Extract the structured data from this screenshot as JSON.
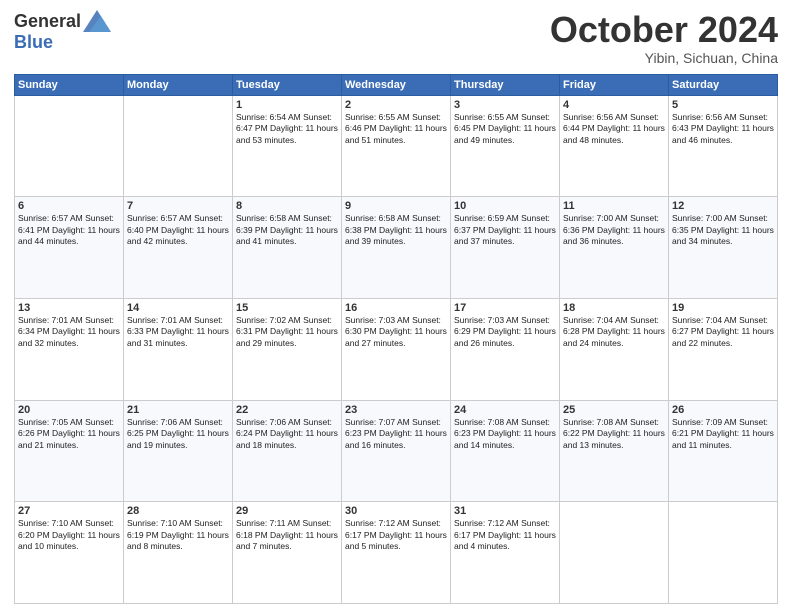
{
  "header": {
    "logo_general": "General",
    "logo_blue": "Blue",
    "month": "October 2024",
    "location": "Yibin, Sichuan, China"
  },
  "weekdays": [
    "Sunday",
    "Monday",
    "Tuesday",
    "Wednesday",
    "Thursday",
    "Friday",
    "Saturday"
  ],
  "weeks": [
    [
      {
        "day": "",
        "info": ""
      },
      {
        "day": "",
        "info": ""
      },
      {
        "day": "1",
        "info": "Sunrise: 6:54 AM\nSunset: 6:47 PM\nDaylight: 11 hours and 53 minutes."
      },
      {
        "day": "2",
        "info": "Sunrise: 6:55 AM\nSunset: 6:46 PM\nDaylight: 11 hours and 51 minutes."
      },
      {
        "day": "3",
        "info": "Sunrise: 6:55 AM\nSunset: 6:45 PM\nDaylight: 11 hours and 49 minutes."
      },
      {
        "day": "4",
        "info": "Sunrise: 6:56 AM\nSunset: 6:44 PM\nDaylight: 11 hours and 48 minutes."
      },
      {
        "day": "5",
        "info": "Sunrise: 6:56 AM\nSunset: 6:43 PM\nDaylight: 11 hours and 46 minutes."
      }
    ],
    [
      {
        "day": "6",
        "info": "Sunrise: 6:57 AM\nSunset: 6:41 PM\nDaylight: 11 hours and 44 minutes."
      },
      {
        "day": "7",
        "info": "Sunrise: 6:57 AM\nSunset: 6:40 PM\nDaylight: 11 hours and 42 minutes."
      },
      {
        "day": "8",
        "info": "Sunrise: 6:58 AM\nSunset: 6:39 PM\nDaylight: 11 hours and 41 minutes."
      },
      {
        "day": "9",
        "info": "Sunrise: 6:58 AM\nSunset: 6:38 PM\nDaylight: 11 hours and 39 minutes."
      },
      {
        "day": "10",
        "info": "Sunrise: 6:59 AM\nSunset: 6:37 PM\nDaylight: 11 hours and 37 minutes."
      },
      {
        "day": "11",
        "info": "Sunrise: 7:00 AM\nSunset: 6:36 PM\nDaylight: 11 hours and 36 minutes."
      },
      {
        "day": "12",
        "info": "Sunrise: 7:00 AM\nSunset: 6:35 PM\nDaylight: 11 hours and 34 minutes."
      }
    ],
    [
      {
        "day": "13",
        "info": "Sunrise: 7:01 AM\nSunset: 6:34 PM\nDaylight: 11 hours and 32 minutes."
      },
      {
        "day": "14",
        "info": "Sunrise: 7:01 AM\nSunset: 6:33 PM\nDaylight: 11 hours and 31 minutes."
      },
      {
        "day": "15",
        "info": "Sunrise: 7:02 AM\nSunset: 6:31 PM\nDaylight: 11 hours and 29 minutes."
      },
      {
        "day": "16",
        "info": "Sunrise: 7:03 AM\nSunset: 6:30 PM\nDaylight: 11 hours and 27 minutes."
      },
      {
        "day": "17",
        "info": "Sunrise: 7:03 AM\nSunset: 6:29 PM\nDaylight: 11 hours and 26 minutes."
      },
      {
        "day": "18",
        "info": "Sunrise: 7:04 AM\nSunset: 6:28 PM\nDaylight: 11 hours and 24 minutes."
      },
      {
        "day": "19",
        "info": "Sunrise: 7:04 AM\nSunset: 6:27 PM\nDaylight: 11 hours and 22 minutes."
      }
    ],
    [
      {
        "day": "20",
        "info": "Sunrise: 7:05 AM\nSunset: 6:26 PM\nDaylight: 11 hours and 21 minutes."
      },
      {
        "day": "21",
        "info": "Sunrise: 7:06 AM\nSunset: 6:25 PM\nDaylight: 11 hours and 19 minutes."
      },
      {
        "day": "22",
        "info": "Sunrise: 7:06 AM\nSunset: 6:24 PM\nDaylight: 11 hours and 18 minutes."
      },
      {
        "day": "23",
        "info": "Sunrise: 7:07 AM\nSunset: 6:23 PM\nDaylight: 11 hours and 16 minutes."
      },
      {
        "day": "24",
        "info": "Sunrise: 7:08 AM\nSunset: 6:23 PM\nDaylight: 11 hours and 14 minutes."
      },
      {
        "day": "25",
        "info": "Sunrise: 7:08 AM\nSunset: 6:22 PM\nDaylight: 11 hours and 13 minutes."
      },
      {
        "day": "26",
        "info": "Sunrise: 7:09 AM\nSunset: 6:21 PM\nDaylight: 11 hours and 11 minutes."
      }
    ],
    [
      {
        "day": "27",
        "info": "Sunrise: 7:10 AM\nSunset: 6:20 PM\nDaylight: 11 hours and 10 minutes."
      },
      {
        "day": "28",
        "info": "Sunrise: 7:10 AM\nSunset: 6:19 PM\nDaylight: 11 hours and 8 minutes."
      },
      {
        "day": "29",
        "info": "Sunrise: 7:11 AM\nSunset: 6:18 PM\nDaylight: 11 hours and 7 minutes."
      },
      {
        "day": "30",
        "info": "Sunrise: 7:12 AM\nSunset: 6:17 PM\nDaylight: 11 hours and 5 minutes."
      },
      {
        "day": "31",
        "info": "Sunrise: 7:12 AM\nSunset: 6:17 PM\nDaylight: 11 hours and 4 minutes."
      },
      {
        "day": "",
        "info": ""
      },
      {
        "day": "",
        "info": ""
      }
    ]
  ]
}
